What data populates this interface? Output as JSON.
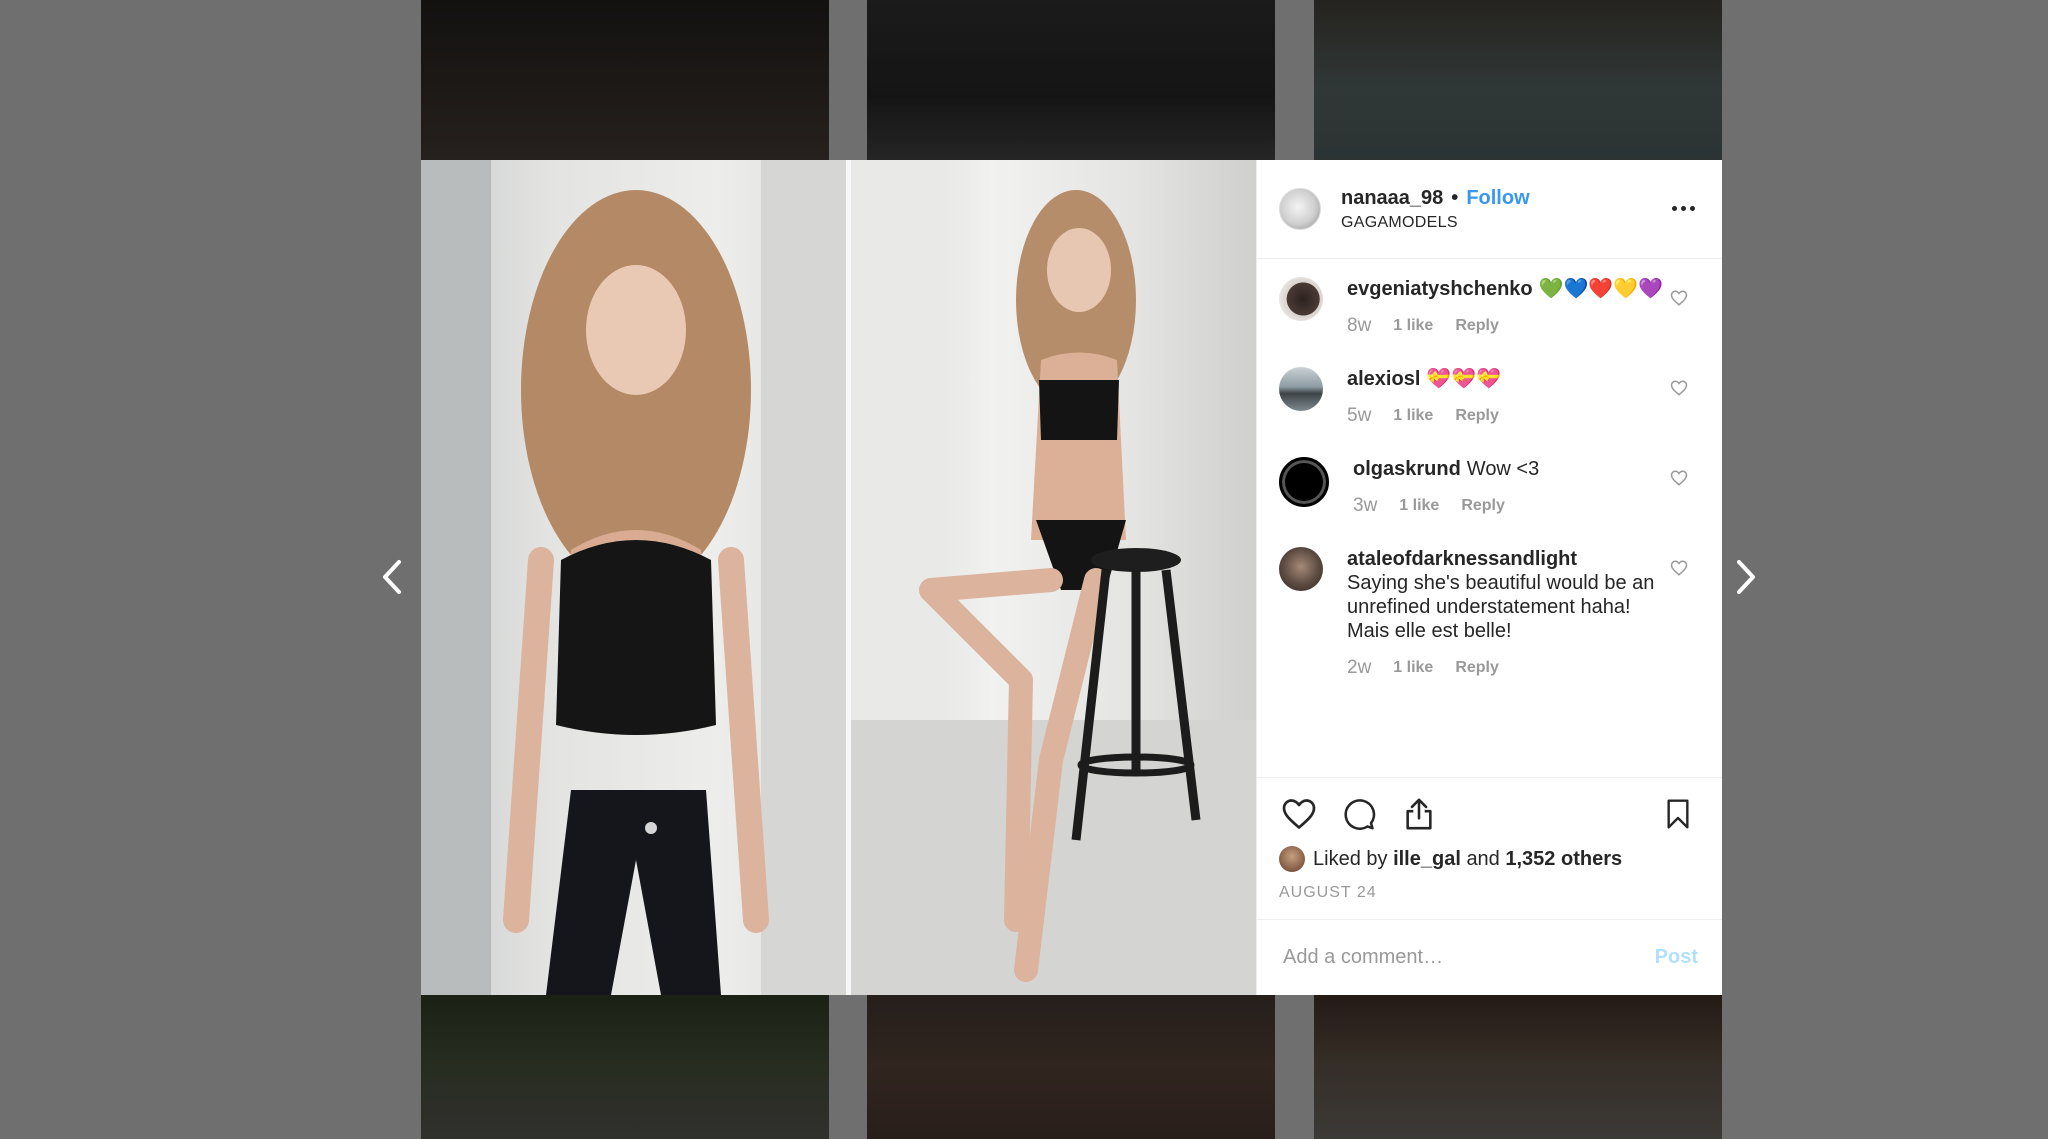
{
  "post": {
    "username": "nanaaa_98",
    "separator": "•",
    "follow_label": "Follow",
    "location": "GAGAMODELS"
  },
  "comments": [
    {
      "username": "evgeniatyshchenko",
      "text": "💚💙❤️💛💜",
      "time": "8w",
      "likes": "1 like",
      "reply": "Reply"
    },
    {
      "username": "alexiosl",
      "text": "💝💝💝",
      "time": "5w",
      "likes": "1 like",
      "reply": "Reply"
    },
    {
      "username": "olgaskrund",
      "text": "Wow <3",
      "time": "3w",
      "likes": "1 like",
      "reply": "Reply"
    },
    {
      "username": "ataleofdarknessandlight",
      "text": "Saying she's beautiful would be an unrefined understatement haha! Mais elle est belle!",
      "time": "2w",
      "likes": "1 like",
      "reply": "Reply"
    }
  ],
  "likes": {
    "prefix": "Liked by",
    "user": "ille_gal",
    "and": "and",
    "others": "1,352 others"
  },
  "date": "AUGUST 24",
  "add_comment": {
    "placeholder": "Add a comment…",
    "post_label": "Post"
  },
  "icons": {
    "prev": "chevron-left-icon",
    "next": "chevron-right-icon",
    "more": "more-options-icon",
    "like": "heart-icon",
    "comment": "comment-bubble-icon",
    "share": "share-icon",
    "save": "bookmark-icon"
  },
  "colors": {
    "accent": "#3897f0",
    "post_disabled": "#b2dffc",
    "muted_text": "#999999",
    "text": "#262626",
    "backdrop": "#6f6f6f"
  }
}
